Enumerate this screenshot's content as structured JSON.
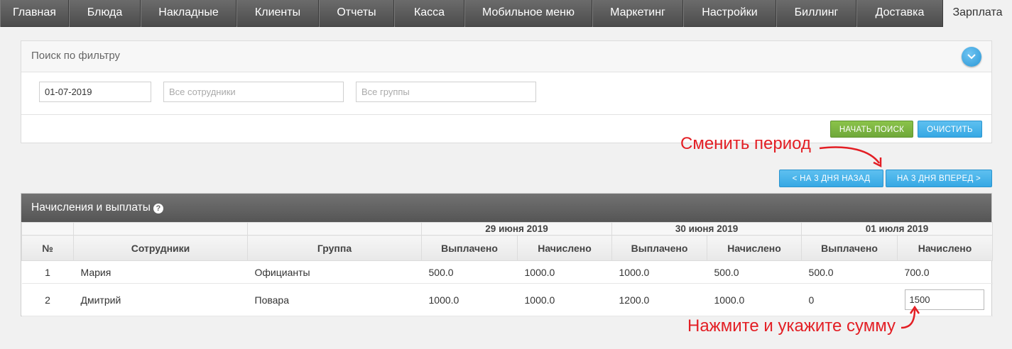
{
  "nav": {
    "items": [
      "Главная",
      "Блюда",
      "Накладные",
      "Клиенты",
      "Отчеты",
      "Касса",
      "Мобильное меню",
      "Маркетинг",
      "Настройки",
      "Биллинг",
      "Доставка",
      "Зарплата"
    ],
    "active": "Зарплата"
  },
  "filter": {
    "title": "Поиск по фильтру",
    "date_value": "01-07-2019",
    "employees_placeholder": "Все сотрудники",
    "groups_placeholder": "Все группы",
    "search_button": "НАЧАТЬ ПОИСК",
    "clear_button": "ОЧИСТИТЬ"
  },
  "annotations": {
    "change_period": "Сменить период",
    "enter_amount": "Нажмите и укажите сумму"
  },
  "period": {
    "back_button": "< НА 3 ДНЯ НАЗАД",
    "forward_button": "НА 3 ДНЯ ВПЕРЕД >"
  },
  "table": {
    "title": "Начисления и выплаты",
    "dates": [
      "29 июня 2019",
      "30 июня 2019",
      "01 июля 2019"
    ],
    "headers": {
      "num": "№",
      "employees": "Сотрудники",
      "group": "Группа",
      "paid": "Выплачено",
      "accrued": "Начислено"
    },
    "rows": [
      {
        "num": "1",
        "name": "Мария",
        "group": "Официанты",
        "values": [
          "500.0",
          "1000.0",
          "1000.0",
          "500.0",
          "500.0",
          "700.0"
        ]
      },
      {
        "num": "2",
        "name": "Дмитрий",
        "group": "Повара",
        "values": [
          "1000.0",
          "1000.0",
          "1200.0",
          "1000.0",
          "0",
          "1500"
        ]
      }
    ]
  },
  "colors": {
    "nav_bg": "#555555",
    "green_button": "#7cb342",
    "blue_button": "#3aabe6",
    "annotation_red": "#e31e24"
  }
}
